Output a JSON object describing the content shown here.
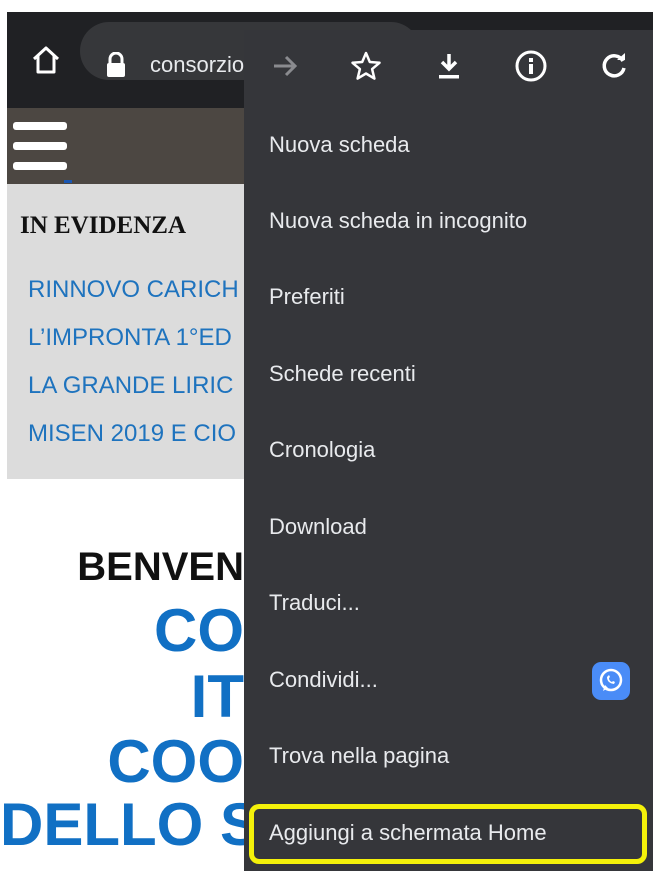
{
  "browser": {
    "url": "consorzio",
    "icons": [
      "home-icon",
      "lock-icon"
    ]
  },
  "page": {
    "evidenza_title": "IN EVIDENZA",
    "evidenza_links": [
      "RINNOVO CARICH",
      "L’IMPRONTA 1°ED",
      "LA GRANDE LIRIC",
      "MISEN 2019 E CIO"
    ],
    "hero_lines": [
      "BENVEN",
      "CO",
      "IT",
      "COO",
      "DELLO S"
    ],
    "hero_colors": {
      "black": "#111111",
      "blue": "#1170c4"
    }
  },
  "menu": {
    "top_icons": [
      "forward-arrow-icon",
      "star-icon",
      "download-icon",
      "info-icon",
      "refresh-icon"
    ],
    "items": [
      "Nuova scheda",
      "Nuova scheda in incognito",
      "Preferiti",
      "Schede recenti",
      "Cronologia",
      "Download",
      "Traduci...",
      "Condividi...",
      "Trova nella pagina",
      "Aggiungi a schermata Home"
    ],
    "share_app_icon": "whatsapp-icon",
    "highlight_color": "#f4f10a"
  }
}
